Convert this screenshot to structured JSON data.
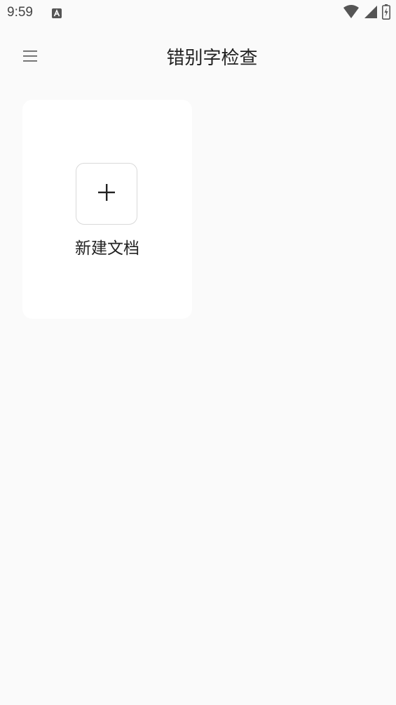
{
  "status_bar": {
    "time": "9:59",
    "icons": [
      "notification-a-icon",
      "wifi-icon",
      "signal-icon",
      "battery-charging-icon"
    ]
  },
  "app_bar": {
    "menu_icon": "hamburger-menu-icon",
    "title": "错别字检查"
  },
  "documents": {
    "new_document_label": "新建文档",
    "add_icon": "plus-icon"
  },
  "colors": {
    "background": "#fafafa",
    "card": "#ffffff",
    "text": "#222222",
    "border": "#d9d9d9"
  }
}
